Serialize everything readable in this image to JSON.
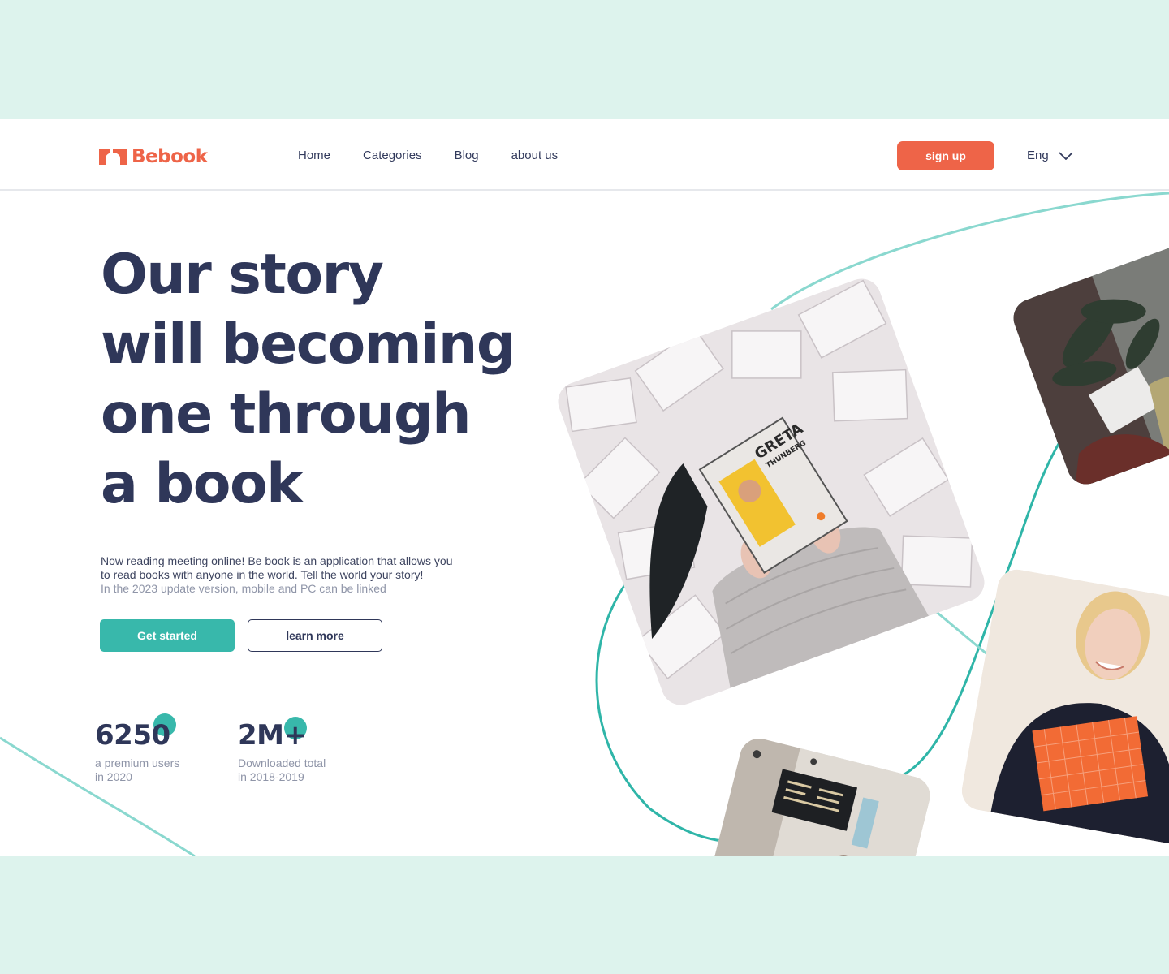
{
  "brand": {
    "name": "Bebook",
    "color": "#ee6448"
  },
  "nav": {
    "items": [
      {
        "label": "Home"
      },
      {
        "label": "Categories"
      },
      {
        "label": "Blog"
      },
      {
        "label": "about us"
      }
    ]
  },
  "header": {
    "signup_label": "sign up",
    "language": "Eng"
  },
  "hero": {
    "title_lines": [
      "Our story",
      "will becoming",
      "one through",
      "a book"
    ],
    "description_lines": [
      "Now reading meeting online! Be book is an application that allows you",
      "to read books with anyone in the world. Tell the world your story!"
    ],
    "note": "In the 2023 update version, mobile and PC can be linked",
    "primary_cta": "Get started",
    "secondary_cta": "learn more"
  },
  "stats": [
    {
      "value": "6250",
      "label_line1": "a premium users",
      "label_line2": "in 2020"
    },
    {
      "value": "2M+",
      "label_line1": "Downloaded total",
      "label_line2": "in 2018-2019"
    }
  ],
  "photos": {
    "main": {
      "book_title": "GRETA",
      "book_subtitle": "THUNBERG"
    }
  },
  "colors": {
    "accent": "#38b8ab",
    "brand": "#ee6448",
    "text": "#2f3759",
    "page_bg": "#ddf3ed"
  },
  "icons": [
    "logo-icon",
    "chevron-down-icon"
  ]
}
